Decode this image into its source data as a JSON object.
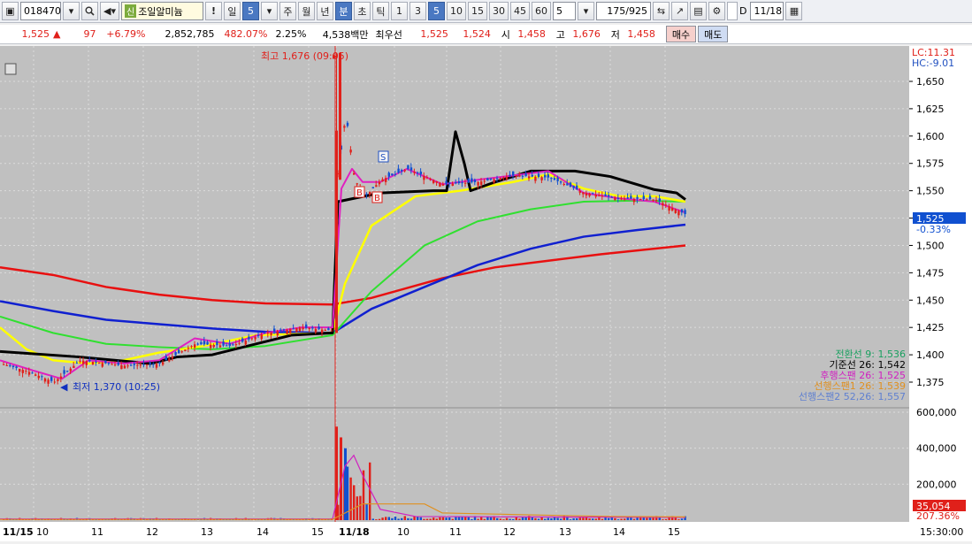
{
  "toolbar": {
    "code": "018470",
    "badge": "신",
    "stock_name": "조일알미늄",
    "exclaim": "!",
    "period_day": "일",
    "period_num": "5",
    "btn_week": "주",
    "btn_month": "월",
    "btn_year": "년",
    "btn_min": "분",
    "btn_sec": "초",
    "btn_tick": "틱",
    "interval_1": "1",
    "interval_3": "3",
    "interval_5": "5",
    "interval_10": "10",
    "interval_15": "15",
    "interval_30": "30",
    "interval_45": "45",
    "interval_60": "60",
    "custom_interval": "5",
    "bar_count": "175",
    "bar_total": "/925",
    "date_checkbox_label": "D",
    "date": "11/18"
  },
  "quote": {
    "price": "1,525",
    "arrow": "▲",
    "change": "97",
    "change_pct": "+6.79%",
    "volume": "2,852,785",
    "volume_ratio": "482.07%",
    "turnover_pct": "2.25%",
    "amount": "4,538백만",
    "best_label": "최우선",
    "best_ask": "1,525",
    "best_bid": "1,524",
    "open_label": "시",
    "open": "1,458",
    "high_label": "고",
    "high": "1,676",
    "low_label": "저",
    "low": "1,458",
    "buy_label": "매수",
    "sell_label": "매도"
  },
  "chart_data": {
    "type": "candlestick",
    "price_axis": {
      "min": 1350,
      "max": 1670,
      "ticks": [
        "1,650",
        "1,625",
        "1,600",
        "1,575",
        "1,550",
        "1,525",
        "1,500",
        "1,475",
        "1,450",
        "1,425",
        "1,400",
        "1,375"
      ]
    },
    "volume_axis": {
      "max": 600000,
      "ticks": [
        "600,000",
        "400,000",
        "200,000"
      ]
    },
    "x_ticks": [
      "11/15",
      "10",
      "11",
      "12",
      "13",
      "14",
      "15",
      "11/18",
      "10",
      "11",
      "12",
      "13",
      "14",
      "15"
    ],
    "top_labels": {
      "lc": "LC:11.31",
      "hc": "HC:-9.01"
    },
    "current_price_tag": "1,525",
    "current_change_tag": "-0.33%",
    "current_volume_tag": "35,054",
    "current_volume_pct": "207.36%",
    "time_label": "15:30:00",
    "high_annotation": "최고 1,676 (09:05)",
    "low_annotation": "최저 1,370 (10:25)",
    "legend": [
      {
        "label": "전환선 9: 1,536",
        "color": "#1aa060"
      },
      {
        "label": "기준선 26: 1,542",
        "color": "#000000"
      },
      {
        "label": "후행스팬 26: 1,525",
        "color": "#d020c0"
      },
      {
        "label": "선행스팬1 26: 1,539",
        "color": "#e09020"
      },
      {
        "label": "선행스팬2 52,26: 1,557",
        "color": "#6080d0"
      }
    ],
    "signals": [
      "B",
      "B",
      "S"
    ],
    "ma_red": [
      [
        0,
        1480
      ],
      [
        60,
        1473
      ],
      [
        120,
        1462
      ],
      [
        180,
        1455
      ],
      [
        240,
        1450
      ],
      [
        300,
        1447
      ],
      [
        376,
        1446
      ],
      [
        420,
        1452
      ],
      [
        500,
        1470
      ],
      [
        560,
        1480
      ],
      [
        620,
        1486
      ],
      [
        680,
        1492
      ],
      [
        740,
        1497
      ],
      [
        775,
        1500
      ]
    ],
    "ma_blue": [
      [
        0,
        1449
      ],
      [
        60,
        1440
      ],
      [
        120,
        1432
      ],
      [
        180,
        1428
      ],
      [
        240,
        1424
      ],
      [
        300,
        1421
      ],
      [
        376,
        1420
      ],
      [
        420,
        1442
      ],
      [
        480,
        1462
      ],
      [
        540,
        1482
      ],
      [
        600,
        1497
      ],
      [
        660,
        1508
      ],
      [
        720,
        1514
      ],
      [
        775,
        1519
      ]
    ],
    "ma_green": [
      [
        0,
        1435
      ],
      [
        60,
        1420
      ],
      [
        120,
        1410
      ],
      [
        180,
        1407
      ],
      [
        240,
        1405
      ],
      [
        300,
        1408
      ],
      [
        376,
        1418
      ],
      [
        420,
        1458
      ],
      [
        480,
        1500
      ],
      [
        540,
        1522
      ],
      [
        600,
        1533
      ],
      [
        660,
        1540
      ],
      [
        720,
        1541
      ],
      [
        775,
        1540
      ]
    ],
    "ma_yellow": [
      [
        0,
        1425
      ],
      [
        30,
        1405
      ],
      [
        60,
        1395
      ],
      [
        100,
        1392
      ],
      [
        140,
        1395
      ],
      [
        180,
        1402
      ],
      [
        230,
        1408
      ],
      [
        290,
        1418
      ],
      [
        376,
        1420
      ],
      [
        390,
        1465
      ],
      [
        420,
        1518
      ],
      [
        470,
        1545
      ],
      [
        520,
        1550
      ],
      [
        580,
        1558
      ],
      [
        620,
        1565
      ],
      [
        660,
        1552
      ],
      [
        700,
        1545
      ],
      [
        740,
        1545
      ],
      [
        775,
        1540
      ]
    ],
    "kijun": [
      [
        0,
        1403
      ],
      [
        90,
        1398
      ],
      [
        170,
        1392
      ],
      [
        200,
        1398
      ],
      [
        240,
        1400
      ],
      [
        290,
        1410
      ],
      [
        330,
        1418
      ],
      [
        376,
        1420
      ],
      [
        382,
        1540
      ],
      [
        430,
        1548
      ],
      [
        490,
        1550
      ],
      [
        505,
        1550
      ],
      [
        515,
        1604
      ],
      [
        525,
        1575
      ],
      [
        532,
        1550
      ],
      [
        560,
        1558
      ],
      [
        600,
        1568
      ],
      [
        650,
        1568
      ],
      [
        690,
        1563
      ],
      [
        740,
        1551
      ],
      [
        765,
        1548
      ],
      [
        775,
        1542
      ]
    ],
    "magenta": [
      [
        0,
        1395
      ],
      [
        40,
        1385
      ],
      [
        70,
        1378
      ],
      [
        100,
        1395
      ],
      [
        140,
        1392
      ],
      [
        180,
        1395
      ],
      [
        220,
        1415
      ],
      [
        260,
        1410
      ],
      [
        300,
        1420
      ],
      [
        340,
        1425
      ],
      [
        376,
        1425
      ],
      [
        386,
        1552
      ],
      [
        398,
        1570
      ],
      [
        410,
        1558
      ],
      [
        430,
        1558
      ],
      [
        460,
        1570
      ],
      [
        500,
        1556
      ],
      [
        540,
        1560
      ],
      [
        580,
        1564
      ],
      [
        620,
        1568
      ],
      [
        660,
        1548
      ],
      [
        700,
        1543
      ],
      [
        740,
        1540
      ],
      [
        775,
        1530
      ]
    ]
  }
}
